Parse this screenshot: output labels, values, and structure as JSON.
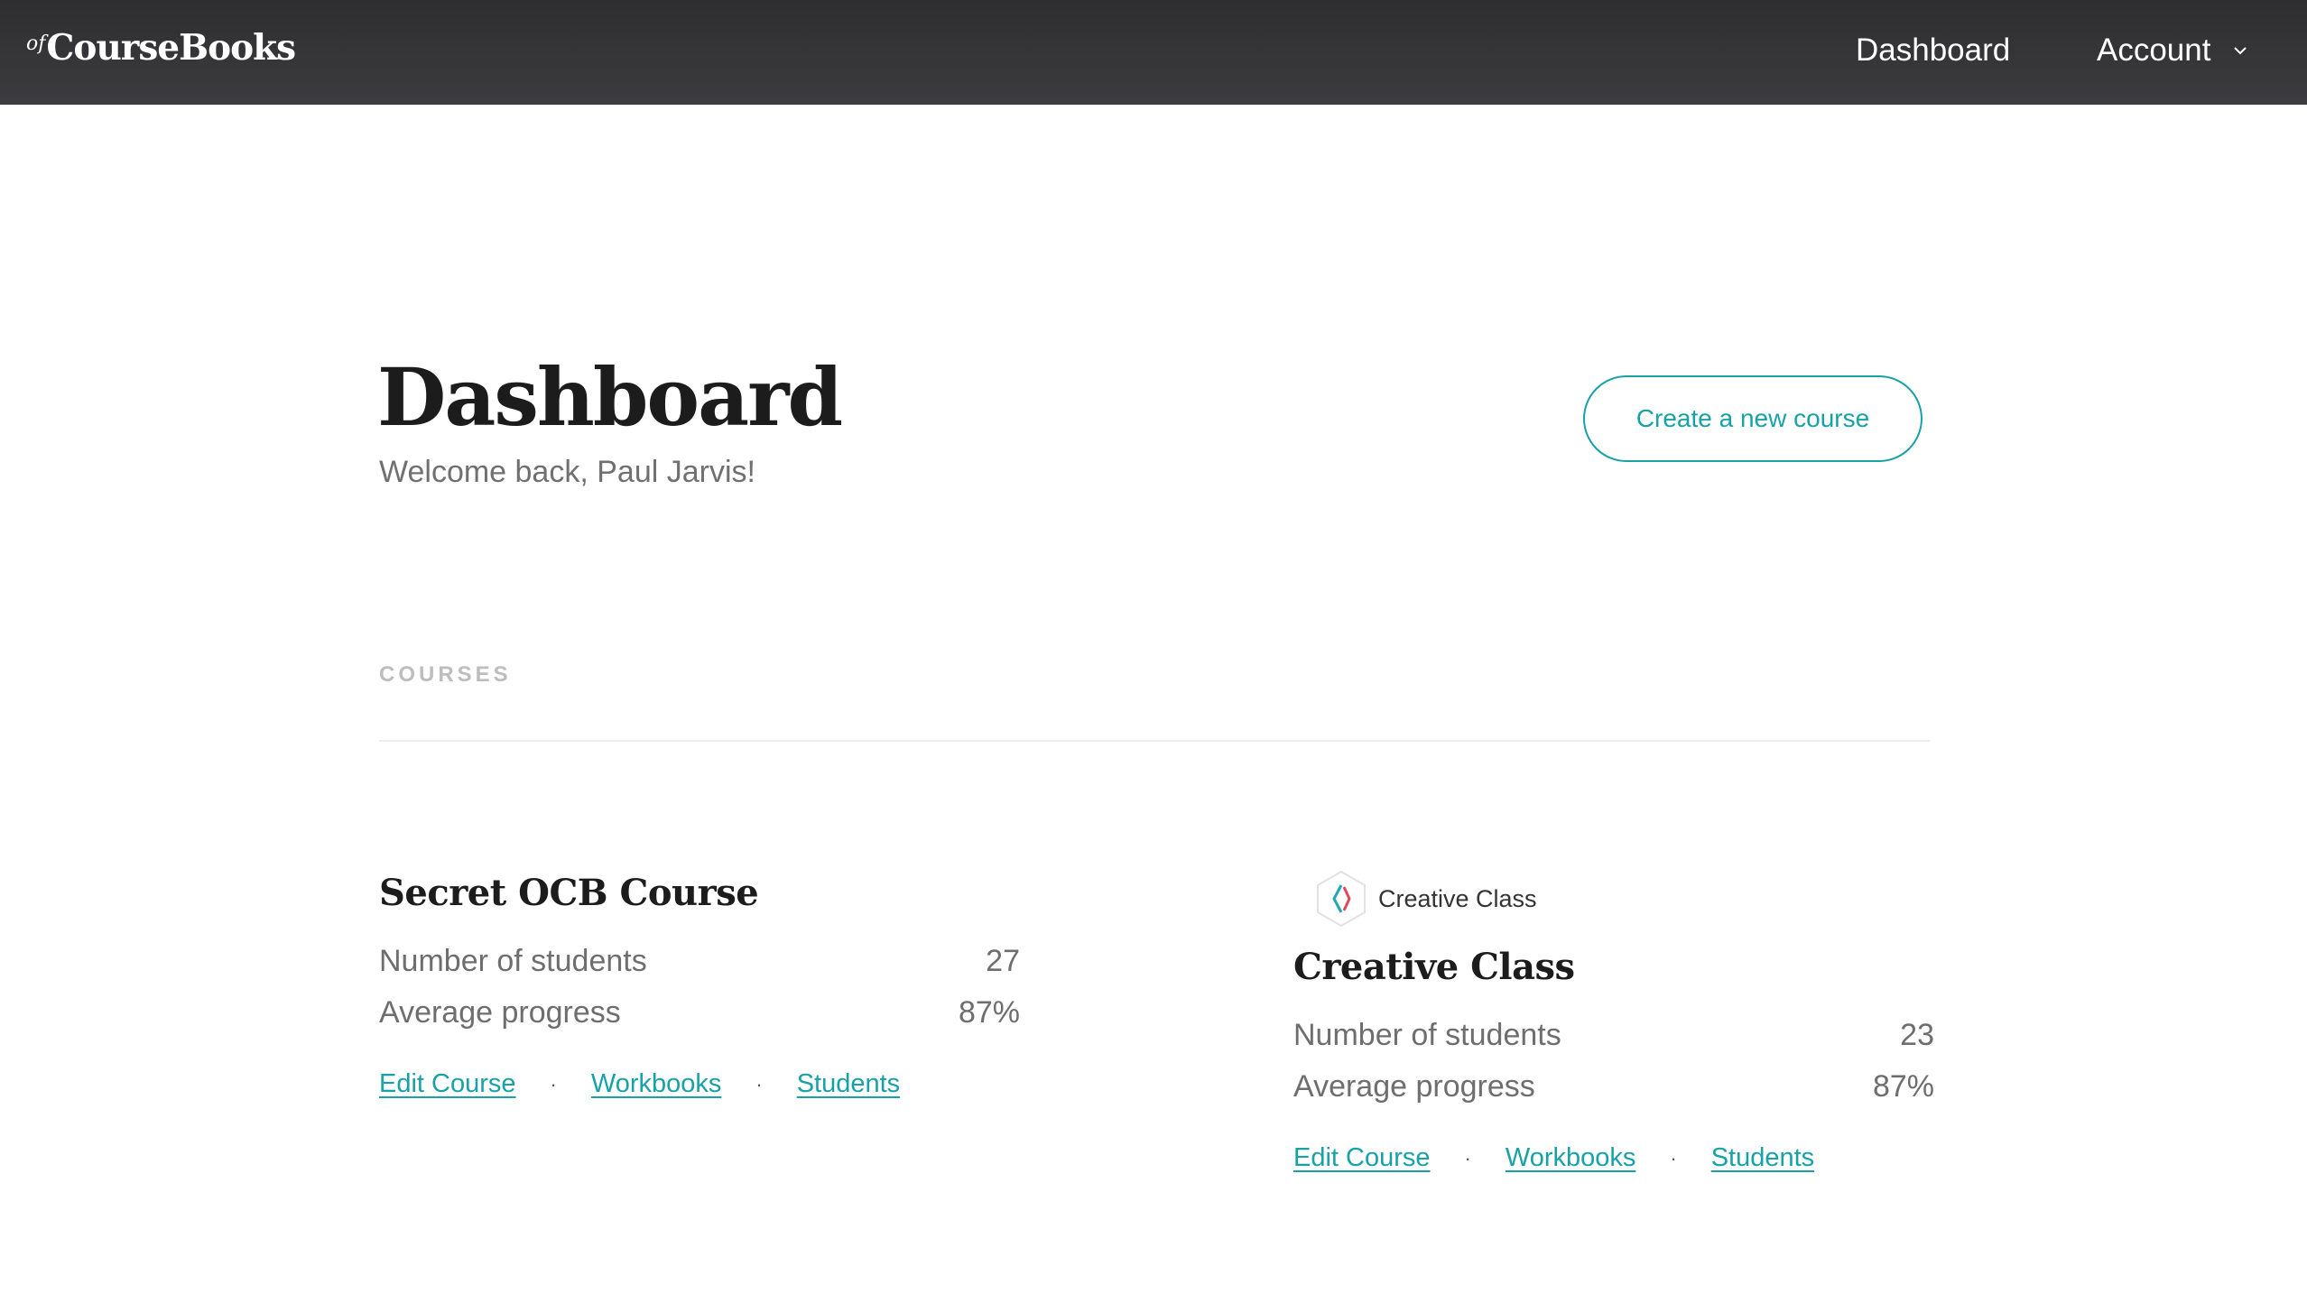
{
  "header": {
    "logo_prefix": "of",
    "logo_name": "CourseBooks",
    "nav_dashboard": "Dashboard",
    "nav_account": "Account"
  },
  "page": {
    "title": "Dashboard",
    "welcome": "Welcome back, Paul Jarvis!",
    "create_button": "Create a new course",
    "courses_label": "COURSES"
  },
  "courses": [
    {
      "title": "Secret OCB Course",
      "students_label": "Number of students",
      "students_value": "27",
      "progress_label": "Average progress",
      "progress_value": "87%",
      "link_edit": "Edit Course",
      "link_workbooks": "Workbooks",
      "link_students": "Students",
      "separator": "·"
    },
    {
      "logo_text": "Creative Class",
      "logo_icon": "creative-class-logo-icon",
      "title": "Creative Class",
      "students_label": "Number of students",
      "students_value": "23",
      "progress_label": "Average progress",
      "progress_value": "87%",
      "link_edit": "Edit Course",
      "link_workbooks": "Workbooks",
      "link_students": "Students",
      "separator": "·"
    }
  ],
  "colors": {
    "accent": "#17a2a8",
    "header_bg": "#333335",
    "muted_text": "#707070",
    "section_label": "#bdbdbd"
  }
}
